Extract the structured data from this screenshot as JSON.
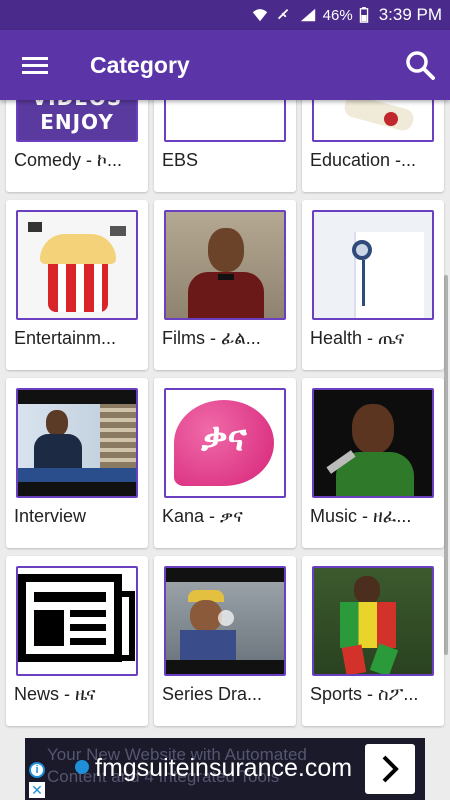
{
  "status_bar": {
    "battery": "46%",
    "time": "3:39 PM"
  },
  "app_bar": {
    "title": "Category"
  },
  "categories": [
    {
      "label": "Comedy - ኮ...",
      "thumb_text": "ET VIDEOS ENJOY"
    },
    {
      "label": "EBS"
    },
    {
      "label": "Education -..."
    },
    {
      "label": "Entertainm..."
    },
    {
      "label": "Films - ፊል..."
    },
    {
      "label": "Health - ጤና"
    },
    {
      "label": "Interview"
    },
    {
      "label": "Kana - ቃና",
      "thumb_text": "ቃና"
    },
    {
      "label": "Music - ዘፈ..."
    },
    {
      "label": "News - ዜና"
    },
    {
      "label": "Series Dra..."
    },
    {
      "label": "Sports - ስፖ..."
    }
  ],
  "ad": {
    "background_text_line1": "Your New Website with Automated",
    "background_text_line2": "Content and 4 Integrated Tools",
    "domain": "fmgsuiteinsurance.com",
    "info_glyph": "i",
    "close_glyph": "✕"
  },
  "colors": {
    "primary": "#5b34a8",
    "status_bar": "#4a2a8a",
    "thumb_border": "#6a3fc0",
    "ad_accent": "#1e8fd8"
  }
}
